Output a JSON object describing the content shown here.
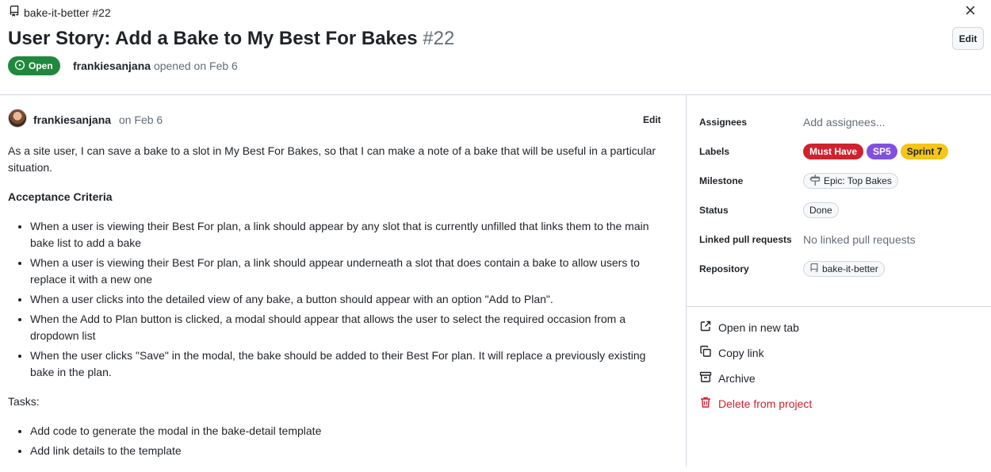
{
  "header": {
    "breadcrumb": "bake-it-better #22",
    "title": "User Story: Add a Bake to My Best For Bakes",
    "number": "#22",
    "edit_label": "Edit",
    "state": "Open",
    "author": "frankiesanjana",
    "opened_text": "opened on Feb 6"
  },
  "comment": {
    "author": "frankiesanjana",
    "date": "on Feb 6",
    "edit_label": "Edit",
    "intro": "As a site user, I can save a bake to a slot in My Best For Bakes, so that I can make a note of a bake that will be useful in a particular situation.",
    "criteria_heading": "Acceptance Criteria",
    "criteria": [
      "When a user is viewing their Best For plan, a link should appear by any slot that is currently unfilled that links them to the main bake list to add a bake",
      "When a user is viewing their Best For plan, a link should appear underneath a slot that does contain a bake to allow users to replace it with a new one",
      "When a user clicks into the detailed view of any bake, a button should appear with an option \"Add to Plan\".",
      "When the Add to Plan button is clicked, a modal should appear that allows the user to select the required occasion from a dropdown list",
      "When the user clicks \"Save\" in the modal, the bake should be added to their Best For plan. It will replace a previously existing bake in the plan."
    ],
    "tasks_heading": "Tasks:",
    "tasks": [
      "Add code to generate the modal in the bake-detail template",
      "Add link details to the template"
    ]
  },
  "sidebar": {
    "assignees_label": "Assignees",
    "assignees_value": "Add assignees...",
    "labels_label": "Labels",
    "labels": [
      {
        "name": "Must Have",
        "bg": "#cf222e",
        "fg": "#ffffff"
      },
      {
        "name": "SP5",
        "bg": "#8250df",
        "fg": "#ffffff"
      },
      {
        "name": "Sprint 7",
        "bg": "#f5c518",
        "fg": "#1f2328"
      }
    ],
    "milestone_label": "Milestone",
    "milestone_value": "Epic: Top Bakes",
    "status_label": "Status",
    "status_value": "Done",
    "linked_label": "Linked pull requests",
    "linked_value": "No linked pull requests",
    "repository_label": "Repository",
    "repository_value": "bake-it-better",
    "actions": {
      "open_new_tab": "Open in new tab",
      "copy_link": "Copy link",
      "archive": "Archive",
      "delete": "Delete from project"
    }
  },
  "colors": {
    "open_green": "#1f883d",
    "danger_red": "#cf222e",
    "border": "#d0d7de",
    "muted": "#656d76"
  }
}
